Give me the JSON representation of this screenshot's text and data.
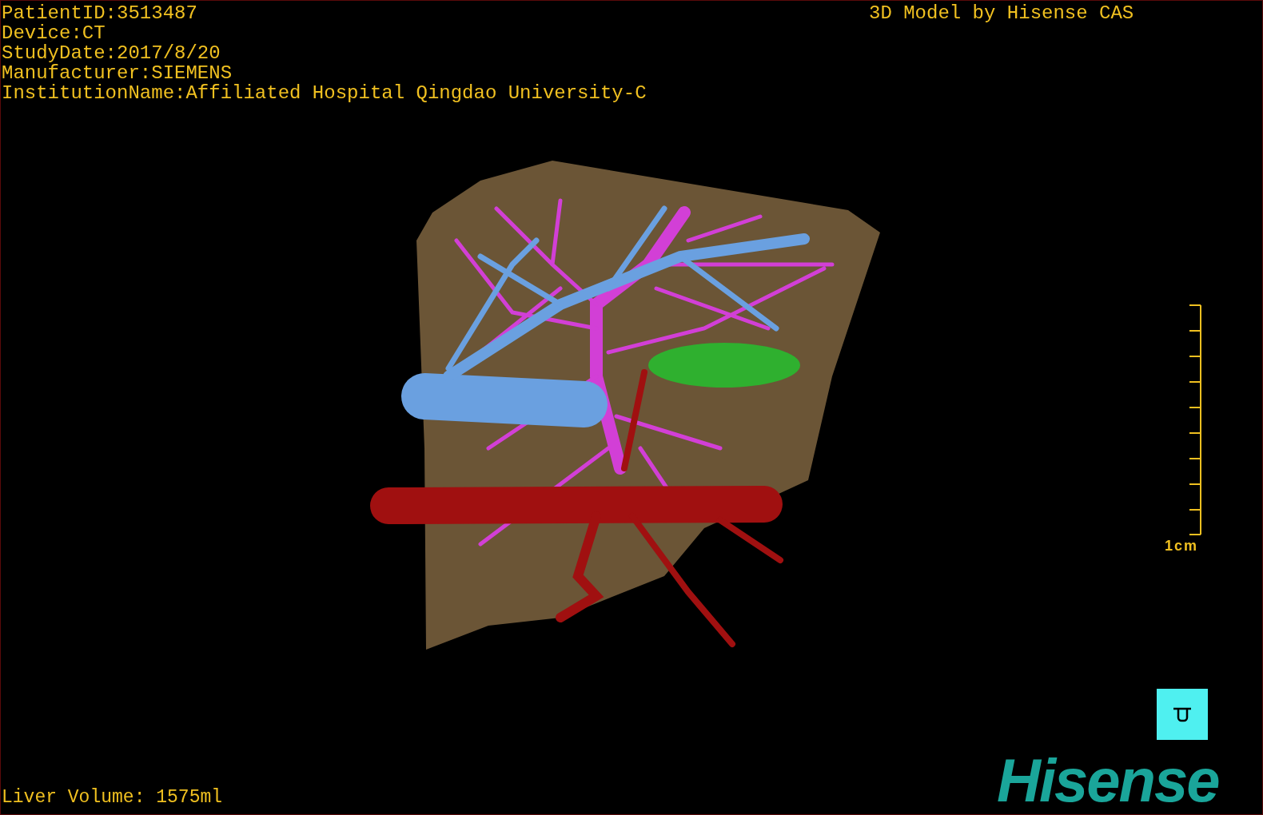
{
  "header_info": [
    "PatientID:3513487",
    "Device:CT",
    "StudyDate:2017/8/20",
    "Manufacturer:SIEMENS",
    "InstitutionName:Affiliated Hospital Qingdao University-C"
  ],
  "title": "3D Model by Hisense CAS",
  "scale_bar": {
    "label": "1cm"
  },
  "liver_volume": "Liver Volume: 1575ml",
  "logo": "Hisense"
}
